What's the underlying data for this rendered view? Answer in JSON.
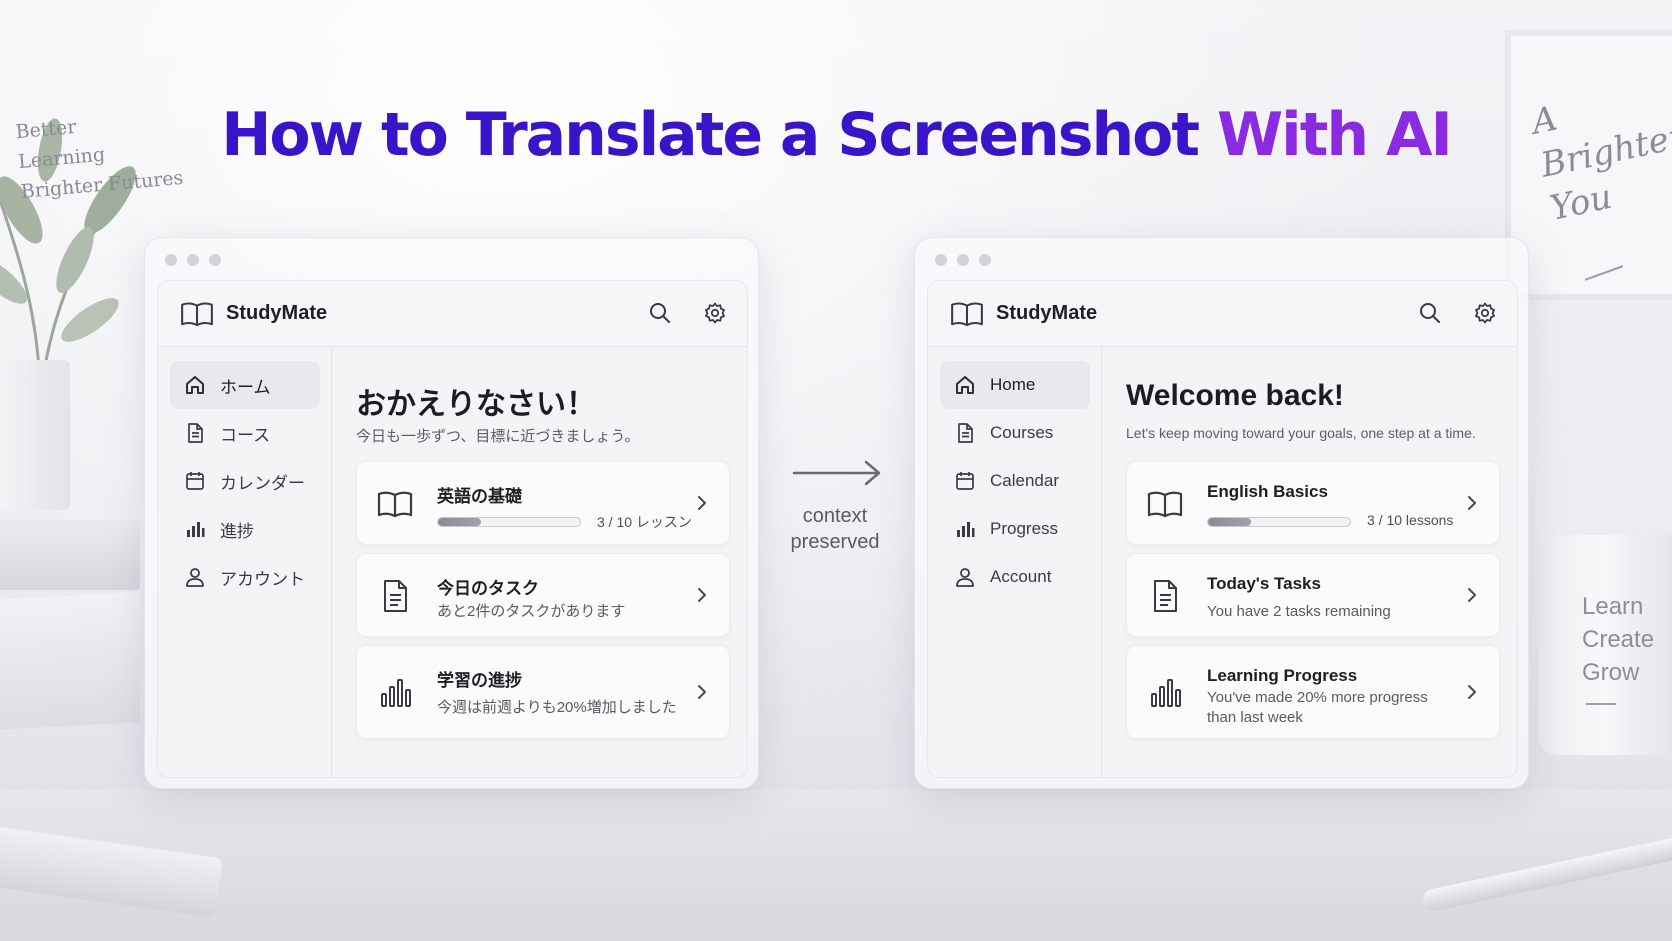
{
  "title": {
    "main": "How to Translate a Screenshot",
    "accent": "With AI"
  },
  "middle": {
    "caption_line1": "context",
    "caption_line2": "preserved"
  },
  "background": {
    "book_lines": [
      "Better",
      "Learning",
      "Brighter Futures"
    ],
    "frame_lines": [
      "A",
      "Brighter",
      "You"
    ],
    "mug_lines": [
      "Learn",
      "Create",
      "Grow"
    ]
  },
  "left_window": {
    "brand": "StudyMate",
    "nav": [
      {
        "label": "ホーム",
        "icon": "home-icon"
      },
      {
        "label": "コース",
        "icon": "document-icon"
      },
      {
        "label": "カレンダー",
        "icon": "calendar-icon"
      },
      {
        "label": "進捗",
        "icon": "bar-chart-icon"
      },
      {
        "label": "アカウント",
        "icon": "user-icon"
      }
    ],
    "welcome": "おかえりなさい！",
    "subtitle": "今日も一歩ずつ、目標に近づきましょう。",
    "cards": [
      {
        "title": "英語の基礎",
        "progress_text": "3 / 10 レッスン",
        "progress": 0.3,
        "icon": "book-icon"
      },
      {
        "title": "今日のタスク",
        "desc": "あと2件のタスクがあります",
        "icon": "document-icon"
      },
      {
        "title": "学習の進捗",
        "desc": "今週は前週よりも20%増加しました",
        "icon": "bar-chart-icon"
      }
    ]
  },
  "right_window": {
    "brand": "StudyMate",
    "nav": [
      {
        "label": "Home",
        "icon": "home-icon"
      },
      {
        "label": "Courses",
        "icon": "document-icon"
      },
      {
        "label": "Calendar",
        "icon": "calendar-icon"
      },
      {
        "label": "Progress",
        "icon": "bar-chart-icon"
      },
      {
        "label": "Account",
        "icon": "user-icon"
      }
    ],
    "welcome": "Welcome back!",
    "subtitle": "Let's keep moving toward your goals, one step at a time.",
    "cards": [
      {
        "title": "English Basics",
        "progress_text": "3 / 10 lessons",
        "progress": 0.3,
        "icon": "book-icon"
      },
      {
        "title": "Today's Tasks",
        "desc": "You have 2 tasks remaining",
        "icon": "document-icon"
      },
      {
        "title": "Learning Progress",
        "desc": "You've made 20% more progress than last week",
        "icon": "bar-chart-icon"
      }
    ]
  },
  "colors": {
    "title": "#3a14c9",
    "title_accent": "#8a2be2",
    "active_nav": "#e8e8ed"
  }
}
